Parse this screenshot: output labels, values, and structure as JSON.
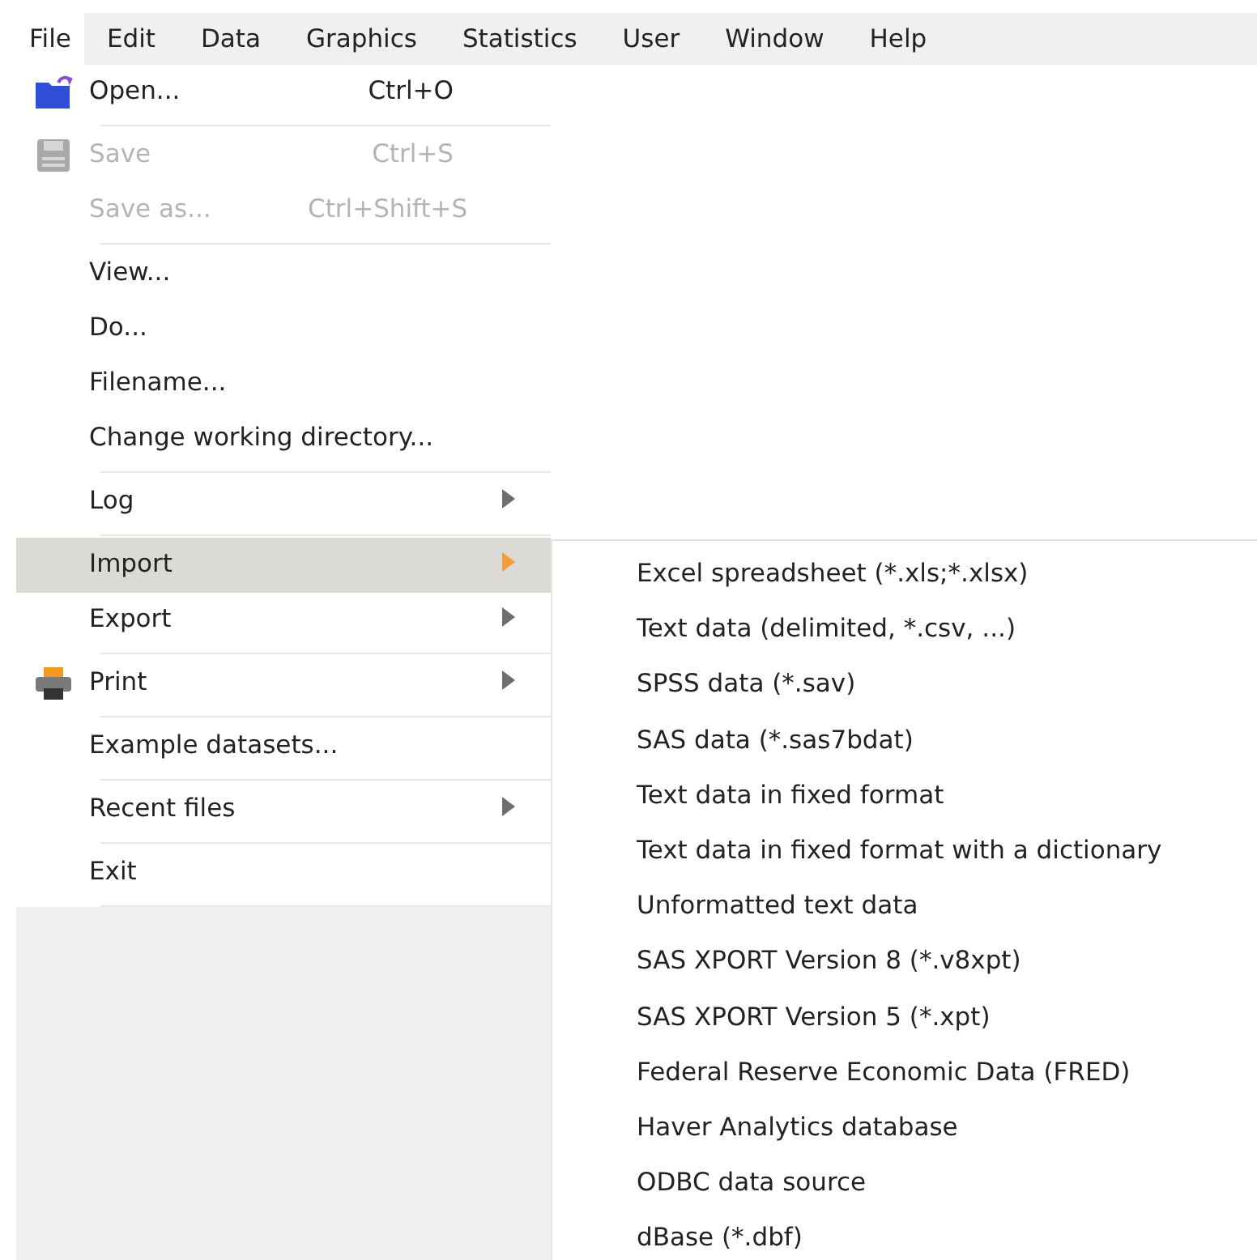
{
  "menubar": [
    {
      "label": "File",
      "selected": true
    },
    {
      "label": "Edit",
      "selected": false
    },
    {
      "label": "Data",
      "selected": false
    },
    {
      "label": "Graphics",
      "selected": false
    },
    {
      "label": "Statistics",
      "selected": false
    },
    {
      "label": "User",
      "selected": false
    },
    {
      "label": "Window",
      "selected": false
    },
    {
      "label": "Help",
      "selected": false
    }
  ],
  "file_menu": [
    [
      {
        "label": "Open...",
        "shortcut": "Ctrl+O",
        "kind": "folder",
        "disabled": false
      }
    ],
    [
      {
        "label": "Save",
        "shortcut": "Ctrl+S",
        "kind": "floppy",
        "disabled": true
      },
      {
        "label": "Save as...",
        "shortcut": "Ctrl+Shift+S",
        "disabled": true
      }
    ],
    [
      {
        "label": "View...",
        "disabled": false
      },
      {
        "label": "Do...",
        "disabled": false
      },
      {
        "label": "Filename...",
        "disabled": false
      },
      {
        "label": "Change working directory...",
        "disabled": false
      }
    ],
    [
      {
        "label": "Log",
        "submenu": true,
        "disabled": false,
        "selected": false
      }
    ],
    [
      {
        "label": "Import",
        "submenu": true,
        "disabled": false,
        "selected": true
      },
      {
        "label": "Export",
        "submenu": true,
        "disabled": false,
        "selected": false
      }
    ],
    [
      {
        "label": "Print",
        "submenu": true,
        "kind": "printer",
        "disabled": false,
        "selected": false
      }
    ],
    [
      {
        "label": "Example datasets...",
        "disabled": false
      }
    ],
    [
      {
        "label": "Recent files",
        "submenu": true,
        "disabled": false,
        "selected": false
      }
    ],
    [
      {
        "label": "Exit",
        "disabled": false
      }
    ]
  ],
  "import_submenu": [
    "Excel spreadsheet (*.xls;*.xlsx)",
    "Text data (delimited, *.csv, ...)",
    "SPSS data (*.sav)",
    "SAS data (*.sas7bdat)",
    "Text data in fixed format",
    "Text data in fixed format with a dictionary",
    "Unformatted text data",
    "SAS XPORT Version 8 (*.v8xpt)",
    "SAS XPORT Version 5 (*.xpt)",
    "Federal Reserve Economic Data (FRED)",
    "Haver Analytics database",
    "ODBC data source",
    "dBase (*.dbf)"
  ]
}
